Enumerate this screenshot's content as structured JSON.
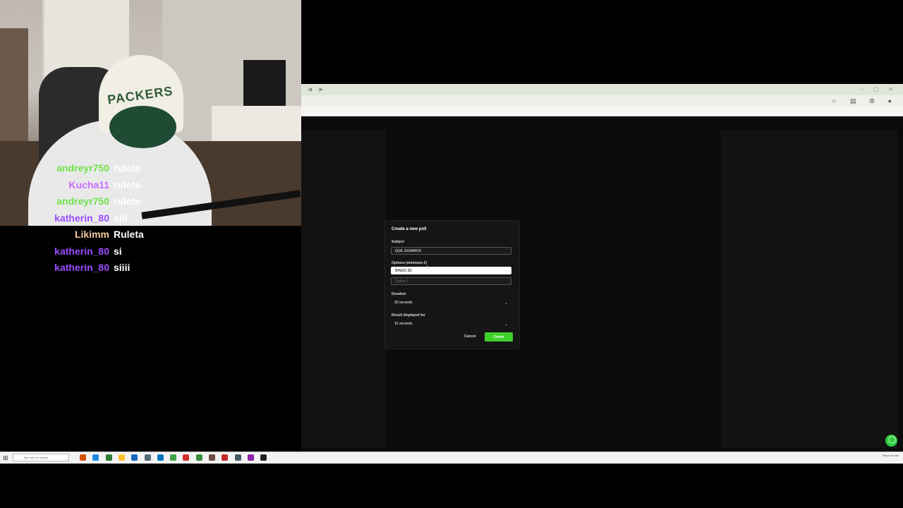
{
  "webcam": {
    "cap_text": "PACKERS"
  },
  "chat": [
    {
      "user": "andreyr750",
      "msg": "ruleta",
      "color": "#6fe34a"
    },
    {
      "user": "Kucha11",
      "msg": "ruleta",
      "color": "#c86bff"
    },
    {
      "user": "andreyr750",
      "msg": "ruleta",
      "color": "#6fe34a"
    },
    {
      "user": "katherin_80",
      "msg": "siii",
      "color": "#9b4dff"
    },
    {
      "user": "Likimm",
      "msg": "Ruleta",
      "color": "#f1c9a0"
    },
    {
      "user": "katherin_80",
      "msg": "si",
      "color": "#9b4dff"
    },
    {
      "user": "katherin_80",
      "msg": "siiii",
      "color": "#9b4dff"
    }
  ],
  "modal": {
    "title": "Create a new poll",
    "subject_label": "Subject",
    "subject_value": "QUE JUGAMOS",
    "options_label": "Options (minimum 2)",
    "option1_value": "BINGO 3D",
    "option2_placeholder": "Option 2",
    "duration_label": "Duration",
    "duration_value": "30 seconds",
    "result_label": "Result displayed for",
    "result_value": "15 seconds",
    "cancel_label": "Cancel",
    "create_label": "Create"
  },
  "taskbar": {
    "search_placeholder": "Type here to search",
    "tray_text": "Temps to rise",
    "icon_colors": [
      "#d35400",
      "#1e88e5",
      "#2e7d32",
      "#fbc02d",
      "#1565c0",
      "#546e7a",
      "#0277bd",
      "#43a047",
      "#d32f2f",
      "#388e3c",
      "#6d4c41",
      "#c62828",
      "#455a64",
      "#8e24aa",
      "#212121"
    ]
  },
  "colors": {
    "accent_green": "#3fd12b"
  }
}
